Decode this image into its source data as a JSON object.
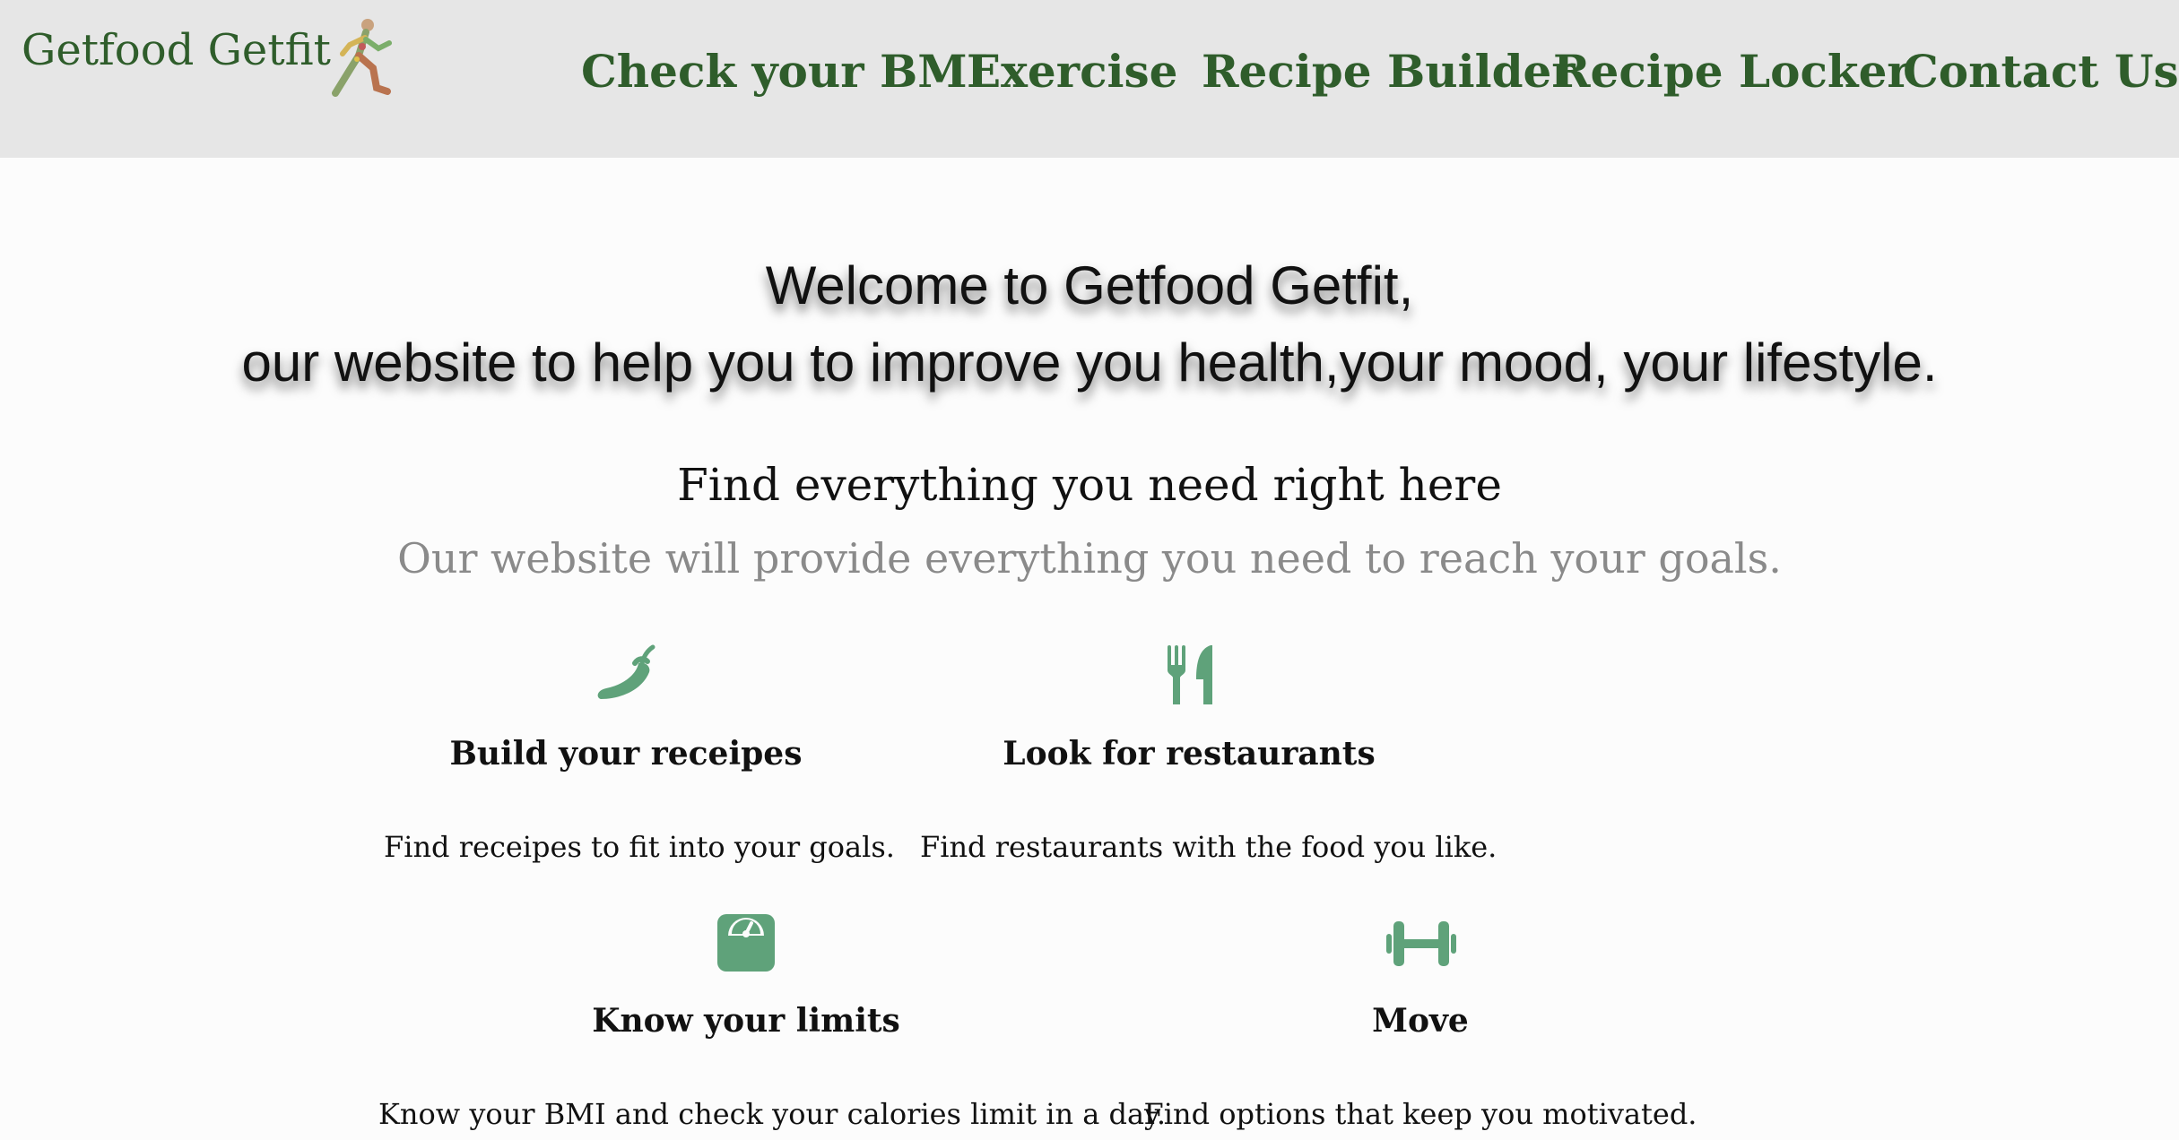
{
  "header": {
    "brand": "Getfood Getfit",
    "logo_icon": "runner-icon",
    "nav": [
      {
        "label": "Check your BMI"
      },
      {
        "label": "Exercise"
      },
      {
        "label": "Recipe Builder"
      },
      {
        "label": "Recipe Locker"
      },
      {
        "label": "Contact Us"
      }
    ]
  },
  "hero": {
    "line1": "Welcome to Getfood Getfit,",
    "line2": "our website to help you to improve you health,your mood, your lifestyle."
  },
  "intro": {
    "heading": "Find everything you need right here",
    "subheading": "Our website will provide everything you need to reach your goals."
  },
  "features": [
    {
      "icon": "chili-pepper-icon",
      "title": "Build your receipes",
      "description": "Find receipes to fit into your goals."
    },
    {
      "icon": "fork-knife-icon",
      "title": "Look for restaurants",
      "description": "Find restaurants with the food you like."
    },
    {
      "icon": "weight-scale-icon",
      "title": "Know your limits",
      "description": "Know your BMI and check your calories limit in a day."
    },
    {
      "icon": "dumbbell-icon",
      "title": "Move",
      "description": "Find options that keep you motivated."
    }
  ],
  "colors": {
    "accent_green": "#2f5d2b",
    "icon_green": "#5fa27a",
    "header_bg": "#e6e6e6"
  }
}
